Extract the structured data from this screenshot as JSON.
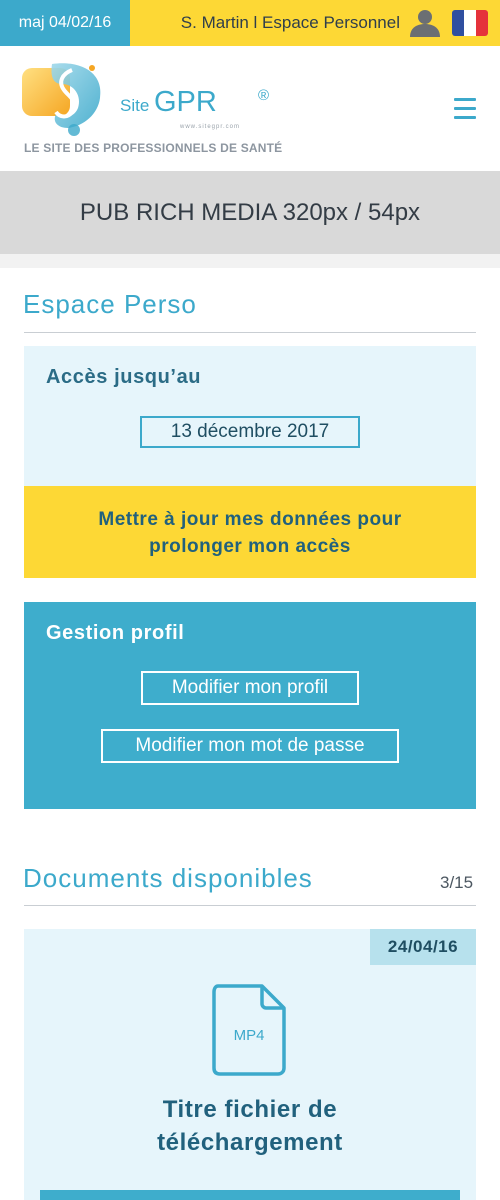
{
  "topbar": {
    "update_label": "maj 04/02/16",
    "user_label": "S. Martin l Espace Personnel",
    "user_icon": "user-icon",
    "flag_icon": "french-flag-icon",
    "colors": {
      "accent": "#3ca9cb",
      "yellow": "#fdd835"
    }
  },
  "header": {
    "logo_site": "Site",
    "logo_gpr": "GPR",
    "logo_reg": "®",
    "logo_url": "www.sitegpr.com",
    "tagline": "LE SITE DES PROFESSIONNELS DE SANTÉ",
    "menu_icon": "hamburger-menu-icon"
  },
  "ad": {
    "label": "PUB RICH MEDIA 320px / 54px"
  },
  "espace_perso": {
    "title": "Espace Perso",
    "access_label": "Accès jusqu’au",
    "access_date": "13 décembre 2017",
    "update_line1": "Mettre à jour mes données pour",
    "update_line2": "prolonger mon accès"
  },
  "gestion": {
    "title": "Gestion profil",
    "edit_profile": "Modifier mon profil",
    "edit_password": "Modifier mon mot de passe"
  },
  "documents": {
    "title": "Documents disponibles",
    "counter": "3/15",
    "items": [
      {
        "date": "24/04/16",
        "file_type": "MP4",
        "title_line1": "Titre fichier de",
        "title_line2": "téléchargement"
      }
    ]
  }
}
